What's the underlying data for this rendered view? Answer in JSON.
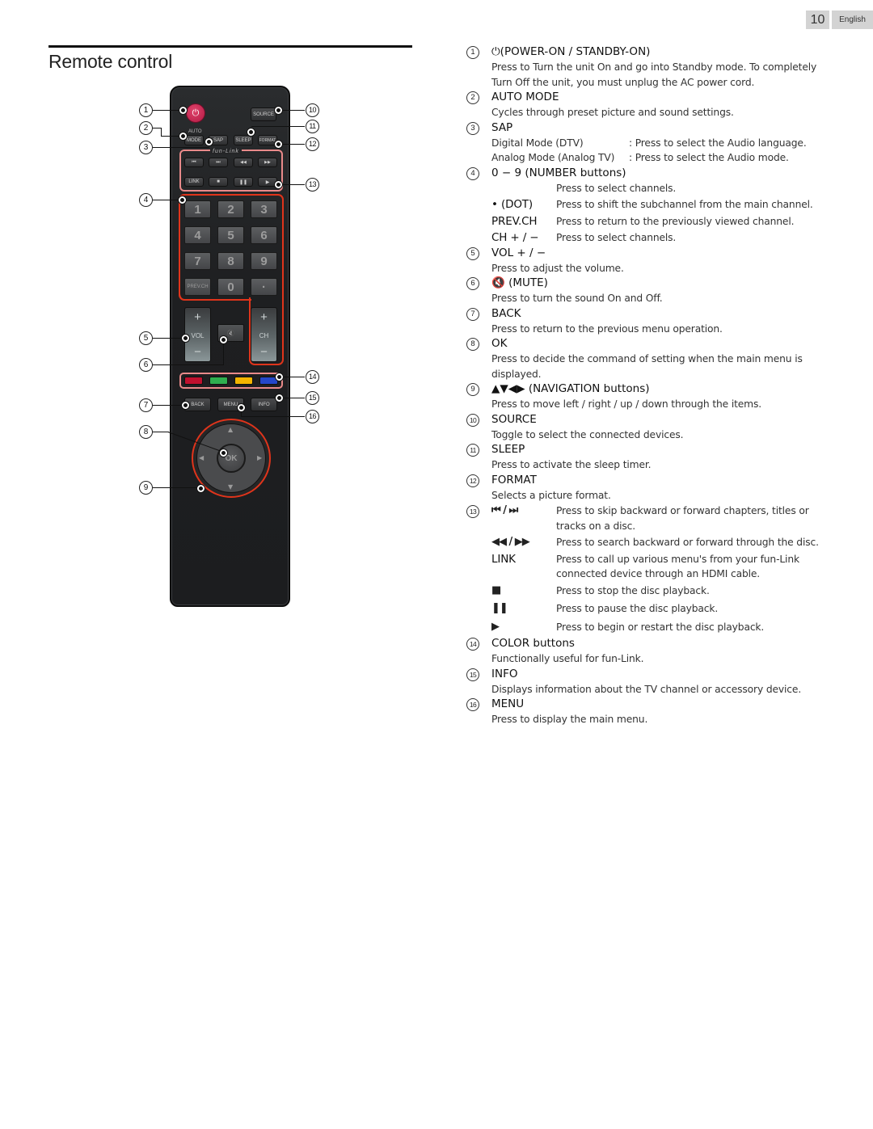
{
  "header": {
    "page_number": "10",
    "language": "English",
    "title": "Remote control"
  },
  "remote": {
    "power_glyph": "⏻",
    "source": "SOURCE",
    "auto_top": "AUTO",
    "mode": "MODE",
    "sap": "SAP",
    "sleep": "SLEEP",
    "format": "FORMAT",
    "funlink_label": "fun-Link",
    "transport": [
      "⏮",
      "⏭",
      "◀◀",
      "▶▶"
    ],
    "transport2": [
      "LINK",
      "■",
      "❚❚",
      "▶"
    ],
    "keys": [
      "1",
      "2",
      "3",
      "4",
      "5",
      "6",
      "7",
      "8",
      "9",
      "PREV.CH",
      "0",
      "·"
    ],
    "vol": {
      "plus": "+",
      "label": "VOL",
      "minus": "−"
    },
    "ch": {
      "plus": "+",
      "label": "CH",
      "minus": "−"
    },
    "mute_glyph": "🔇",
    "color_keys": [
      "#c0102e",
      "#2fae4f",
      "#f4b400",
      "#2447c9"
    ],
    "back": "BACK",
    "menu": "MENU",
    "info": "INFO",
    "ok": "OK",
    "arrows": {
      "up": "▲",
      "down": "▼",
      "left": "◀",
      "right": "▶"
    },
    "callouts": [
      "1",
      "2",
      "3",
      "4",
      "5",
      "6",
      "7",
      "8",
      "9",
      "10",
      "11",
      "12",
      "13",
      "14",
      "15",
      "16"
    ]
  },
  "items": [
    {
      "num": "1",
      "head": "⏻(POWER-ON / STANDBY-ON)",
      "body": [
        "Press to Turn the unit On and go into Standby mode. To completely",
        "Turn Off the unit, you must unplug the AC power cord."
      ]
    },
    {
      "num": "2",
      "head": "AUTO MODE",
      "body": [
        "Cycles through preset picture and sound settings."
      ]
    },
    {
      "num": "3",
      "head": "SAP",
      "rows": [
        {
          "k": "Digital Mode (DTV)",
          "v": ": Press to select the Audio language."
        },
        {
          "k": "Analog Mode (Analog TV)",
          "v": ": Press to select the Audio mode."
        }
      ]
    },
    {
      "num": "4",
      "head": "0 − 9 (NUMBER buttons)",
      "rows": [
        {
          "k": "",
          "v": "Press to select channels."
        },
        {
          "k": "• (DOT)",
          "v": "Press to shift the subchannel from the main channel."
        },
        {
          "k": "PREV.CH",
          "v": "Press to return to the previously viewed channel."
        },
        {
          "k": "CH + / −",
          "v": "Press to select channels."
        }
      ]
    },
    {
      "num": "5",
      "head": "VOL + / −",
      "body": [
        "Press to adjust the volume."
      ]
    },
    {
      "num": "6",
      "head": "🔇 (MUTE)",
      "body": [
        "Press to turn the sound On and Off."
      ]
    },
    {
      "num": "7",
      "head": "BACK",
      "body": [
        "Press to return to the previous menu operation."
      ]
    },
    {
      "num": "8",
      "head": "OK",
      "body": [
        "Press to decide the command of setting when the main menu is",
        "displayed."
      ]
    },
    {
      "num": "9",
      "head": "▲▼◀▶ (NAVIGATION buttons)",
      "body": [
        "Press to move left / right / up / down through the items."
      ]
    },
    {
      "num": "10",
      "head": "SOURCE",
      "body": [
        "Toggle to select the connected devices."
      ]
    },
    {
      "num": "11",
      "head": "SLEEP",
      "body": [
        "Press to activate the sleep timer."
      ]
    },
    {
      "num": "12",
      "head": "FORMAT",
      "body": [
        "Selects a picture format."
      ]
    },
    {
      "num": "13",
      "rows": [
        {
          "k": "⏮ / ⏭",
          "v": "Press to skip backward or forward chapters, titles or",
          "v2": "tracks on a disc."
        },
        {
          "k": "◀◀ / ▶▶",
          "v": "Press to search backward or forward through the disc."
        },
        {
          "k": "LINK",
          "v": "Press to call up various menu's from your fun-Link",
          "v2": "connected device through an HDMI cable."
        },
        {
          "k": "■",
          "v": "Press to stop the disc playback."
        },
        {
          "k": "❚❚",
          "v": "Press to pause the disc playback."
        },
        {
          "k": "▶",
          "v": "Press to begin or restart the disc playback."
        }
      ]
    },
    {
      "num": "14",
      "head": "COLOR buttons",
      "body": [
        "Functionally useful for fun-Link."
      ]
    },
    {
      "num": "15",
      "head": "INFO",
      "body": [
        "Displays information about the TV channel or accessory device."
      ]
    },
    {
      "num": "16",
      "head": "MENU",
      "body": [
        "Press to display the main menu."
      ]
    }
  ]
}
